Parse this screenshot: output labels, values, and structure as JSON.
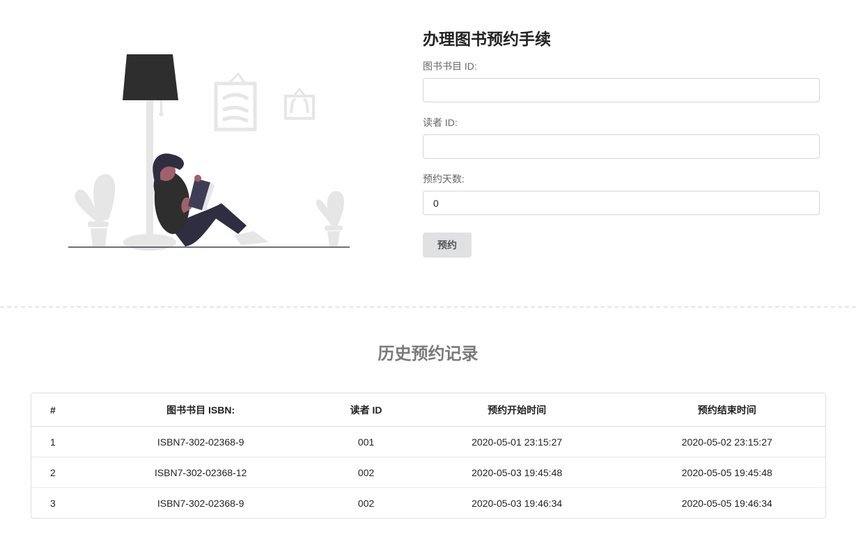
{
  "form": {
    "title": "办理图书预约手续",
    "book_id_label": "图书书目 ID:",
    "book_id_value": "",
    "reader_id_label": "读者 ID:",
    "reader_id_value": "",
    "days_label": "预约天数:",
    "days_value": "0",
    "submit_label": "预约"
  },
  "history": {
    "title": "历史预约记录",
    "columns": [
      "#",
      "图书书目 ISBN:",
      "读者 ID",
      "预约开始时间",
      "预约结束时间"
    ],
    "rows": [
      [
        "1",
        "ISBN7-302-02368-9",
        "001",
        "2020-05-01 23:15:27",
        "2020-05-02 23:15:27"
      ],
      [
        "2",
        "ISBN7-302-02368-12",
        "002",
        "2020-05-03 19:45:48",
        "2020-05-05 19:45:48"
      ],
      [
        "3",
        "ISBN7-302-02368-9",
        "002",
        "2020-05-03 19:46:34",
        "2020-05-05 19:46:34"
      ]
    ]
  },
  "illustration": {
    "icon": "woman-reading-illustration",
    "colors": {
      "lamp_shade": "#2f2e2e",
      "decor_gray": "#e6e6e6",
      "pants": "#2f2e41",
      "skin": "#a0616a",
      "book": "#3f3d56"
    }
  }
}
